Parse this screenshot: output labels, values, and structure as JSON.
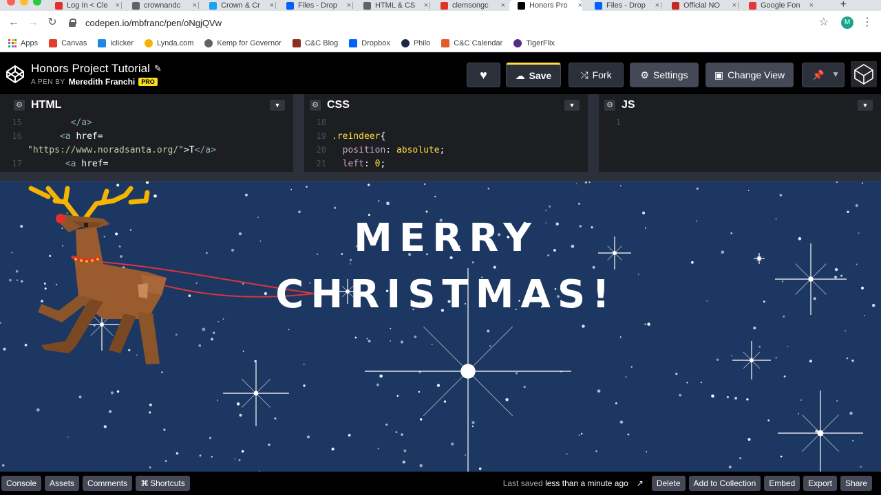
{
  "browser": {
    "tabs": [
      {
        "label": "Log In < Cle",
        "color": "#e0322a"
      },
      {
        "label": "crownandc",
        "color": "#5f6368"
      },
      {
        "label": "Crown & Cr",
        "color": "#1da1f2"
      },
      {
        "label": "Files - Drop",
        "color": "#0061fe"
      },
      {
        "label": "HTML & CS",
        "color": "#5f6368"
      },
      {
        "label": "clemsongc",
        "color": "#e0322a"
      },
      {
        "label": "Honors Pro",
        "color": "#000000"
      },
      {
        "label": "Files - Drop",
        "color": "#0061fe"
      },
      {
        "label": "Official NO",
        "color": "#c62828"
      },
      {
        "label": "Google Fon",
        "color": "#e53935"
      }
    ],
    "url": "codepen.io/mbfranc/pen/oNgjQVw",
    "profile_initial": "M",
    "bookmarks": [
      {
        "label": "Apps",
        "icon": "apps-grid-icon"
      },
      {
        "label": "Canvas",
        "icon": "canvas-icon",
        "color": "#e13f2b"
      },
      {
        "label": "iclicker",
        "icon": "iclicker-icon",
        "color": "#1e88e5"
      },
      {
        "label": "Lynda.com",
        "icon": "lynda-icon",
        "color": "#f5b400"
      },
      {
        "label": "Kemp for Governor",
        "icon": "globe-icon",
        "color": "#5f6368"
      },
      {
        "label": "C&C Blog",
        "icon": "hourglass-icon",
        "color": "#8d2f1e"
      },
      {
        "label": "Dropbox",
        "icon": "dropbox-icon",
        "color": "#0061fe"
      },
      {
        "label": "Philo",
        "icon": "philo-icon",
        "color": "#1c2a4a"
      },
      {
        "label": "C&C Calendar",
        "icon": "calendar-icon",
        "color": "#e35b2a"
      },
      {
        "label": "TigerFlix",
        "icon": "tigerflix-icon",
        "color": "#522d80"
      }
    ]
  },
  "pen": {
    "title": "Honors Project Tutorial",
    "by_label": "A PEN BY",
    "author": "Meredith Franchi",
    "badge": "PRO"
  },
  "header_buttons": {
    "save": "Save",
    "fork": "Fork",
    "settings": "Settings",
    "change_view": "Change View"
  },
  "editors": {
    "html": {
      "name": "HTML",
      "lines": [
        {
          "num": "15",
          "code": [
            {
              "t": "        ",
              "c": ""
            },
            {
              "t": "</a>",
              "c": "tag"
            }
          ]
        },
        {
          "num": "16",
          "code": [
            {
              "t": "      ",
              "c": ""
            },
            {
              "t": "<a ",
              "c": "tag"
            },
            {
              "t": "href",
              "c": "attr"
            },
            {
              "t": "=",
              "c": "attr"
            }
          ]
        },
        {
          "num": "",
          "code": [
            {
              "t": "\"https://www.noradsanta.org/\"",
              "c": "str"
            },
            {
              "t": ">T",
              "c": "attr"
            },
            {
              "t": "</a>",
              "c": "tag"
            }
          ]
        },
        {
          "num": "17",
          "code": [
            {
              "t": "       ",
              "c": ""
            },
            {
              "t": "<a ",
              "c": "tag"
            },
            {
              "t": "href",
              "c": "attr"
            },
            {
              "t": "=",
              "c": "attr"
            }
          ]
        }
      ]
    },
    "css": {
      "name": "CSS",
      "lines": [
        {
          "num": "18",
          "code": [
            {
              "t": "",
              "c": ""
            }
          ]
        },
        {
          "num": "19",
          "code": [
            {
              "t": ".reindeer",
              "c": "sel"
            },
            {
              "t": "{",
              "c": "attr"
            }
          ]
        },
        {
          "num": "20",
          "code": [
            {
              "t": "  ",
              "c": ""
            },
            {
              "t": "position",
              "c": "prop"
            },
            {
              "t": ": ",
              "c": "attr"
            },
            {
              "t": "absolute",
              "c": "val"
            },
            {
              "t": ";",
              "c": "attr"
            }
          ]
        },
        {
          "num": "21",
          "code": [
            {
              "t": "  ",
              "c": ""
            },
            {
              "t": "left",
              "c": "prop"
            },
            {
              "t": ": ",
              "c": "attr"
            },
            {
              "t": "0",
              "c": "val"
            },
            {
              "t": ";",
              "c": "attr"
            }
          ]
        }
      ]
    },
    "js": {
      "name": "JS",
      "lines": [
        {
          "num": "1",
          "code": [
            {
              "t": "",
              "c": ""
            }
          ]
        }
      ]
    }
  },
  "preview": {
    "line1": "MERRY",
    "line2": "CHRISTMAS!"
  },
  "footer": {
    "left": [
      "Console",
      "Assets",
      "Comments",
      "Shortcuts"
    ],
    "saved_prefix": "Last saved",
    "saved_time": "less than a minute ago",
    "right": [
      "Delete",
      "Add to Collection",
      "Embed",
      "Export",
      "Share"
    ]
  },
  "colors": {
    "sky": "#1c3761",
    "reindeer": "#9a5b2f",
    "antler": "#f5b400",
    "nose": "#e0322a",
    "save_accent": "#ffdd40"
  }
}
